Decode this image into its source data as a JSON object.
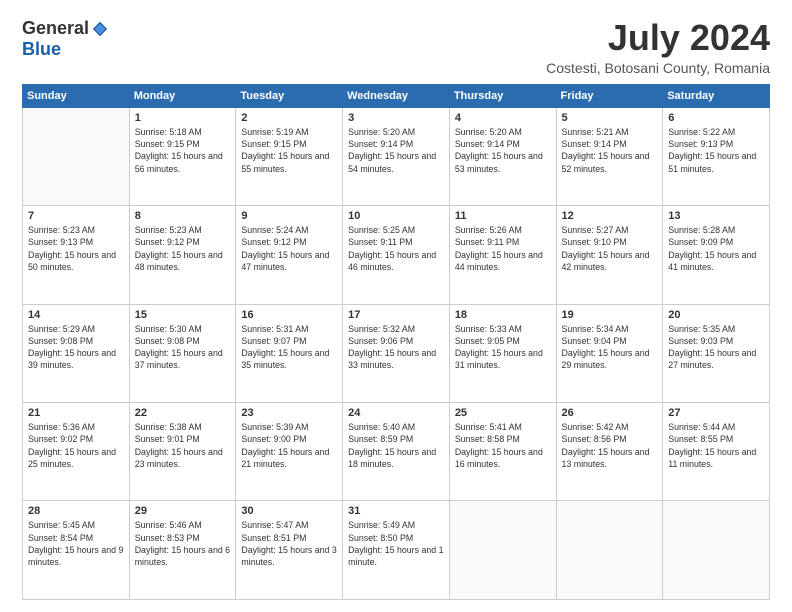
{
  "logo": {
    "general": "General",
    "blue": "Blue"
  },
  "title": {
    "month_year": "July 2024",
    "location": "Costesti, Botosani County, Romania"
  },
  "headers": [
    "Sunday",
    "Monday",
    "Tuesday",
    "Wednesday",
    "Thursday",
    "Friday",
    "Saturday"
  ],
  "weeks": [
    [
      {
        "day": "",
        "sunrise": "",
        "sunset": "",
        "daylight": ""
      },
      {
        "day": "1",
        "sunrise": "Sunrise: 5:18 AM",
        "sunset": "Sunset: 9:15 PM",
        "daylight": "Daylight: 15 hours and 56 minutes."
      },
      {
        "day": "2",
        "sunrise": "Sunrise: 5:19 AM",
        "sunset": "Sunset: 9:15 PM",
        "daylight": "Daylight: 15 hours and 55 minutes."
      },
      {
        "day": "3",
        "sunrise": "Sunrise: 5:20 AM",
        "sunset": "Sunset: 9:14 PM",
        "daylight": "Daylight: 15 hours and 54 minutes."
      },
      {
        "day": "4",
        "sunrise": "Sunrise: 5:20 AM",
        "sunset": "Sunset: 9:14 PM",
        "daylight": "Daylight: 15 hours and 53 minutes."
      },
      {
        "day": "5",
        "sunrise": "Sunrise: 5:21 AM",
        "sunset": "Sunset: 9:14 PM",
        "daylight": "Daylight: 15 hours and 52 minutes."
      },
      {
        "day": "6",
        "sunrise": "Sunrise: 5:22 AM",
        "sunset": "Sunset: 9:13 PM",
        "daylight": "Daylight: 15 hours and 51 minutes."
      }
    ],
    [
      {
        "day": "7",
        "sunrise": "Sunrise: 5:23 AM",
        "sunset": "Sunset: 9:13 PM",
        "daylight": "Daylight: 15 hours and 50 minutes."
      },
      {
        "day": "8",
        "sunrise": "Sunrise: 5:23 AM",
        "sunset": "Sunset: 9:12 PM",
        "daylight": "Daylight: 15 hours and 48 minutes."
      },
      {
        "day": "9",
        "sunrise": "Sunrise: 5:24 AM",
        "sunset": "Sunset: 9:12 PM",
        "daylight": "Daylight: 15 hours and 47 minutes."
      },
      {
        "day": "10",
        "sunrise": "Sunrise: 5:25 AM",
        "sunset": "Sunset: 9:11 PM",
        "daylight": "Daylight: 15 hours and 46 minutes."
      },
      {
        "day": "11",
        "sunrise": "Sunrise: 5:26 AM",
        "sunset": "Sunset: 9:11 PM",
        "daylight": "Daylight: 15 hours and 44 minutes."
      },
      {
        "day": "12",
        "sunrise": "Sunrise: 5:27 AM",
        "sunset": "Sunset: 9:10 PM",
        "daylight": "Daylight: 15 hours and 42 minutes."
      },
      {
        "day": "13",
        "sunrise": "Sunrise: 5:28 AM",
        "sunset": "Sunset: 9:09 PM",
        "daylight": "Daylight: 15 hours and 41 minutes."
      }
    ],
    [
      {
        "day": "14",
        "sunrise": "Sunrise: 5:29 AM",
        "sunset": "Sunset: 9:08 PM",
        "daylight": "Daylight: 15 hours and 39 minutes."
      },
      {
        "day": "15",
        "sunrise": "Sunrise: 5:30 AM",
        "sunset": "Sunset: 9:08 PM",
        "daylight": "Daylight: 15 hours and 37 minutes."
      },
      {
        "day": "16",
        "sunrise": "Sunrise: 5:31 AM",
        "sunset": "Sunset: 9:07 PM",
        "daylight": "Daylight: 15 hours and 35 minutes."
      },
      {
        "day": "17",
        "sunrise": "Sunrise: 5:32 AM",
        "sunset": "Sunset: 9:06 PM",
        "daylight": "Daylight: 15 hours and 33 minutes."
      },
      {
        "day": "18",
        "sunrise": "Sunrise: 5:33 AM",
        "sunset": "Sunset: 9:05 PM",
        "daylight": "Daylight: 15 hours and 31 minutes."
      },
      {
        "day": "19",
        "sunrise": "Sunrise: 5:34 AM",
        "sunset": "Sunset: 9:04 PM",
        "daylight": "Daylight: 15 hours and 29 minutes."
      },
      {
        "day": "20",
        "sunrise": "Sunrise: 5:35 AM",
        "sunset": "Sunset: 9:03 PM",
        "daylight": "Daylight: 15 hours and 27 minutes."
      }
    ],
    [
      {
        "day": "21",
        "sunrise": "Sunrise: 5:36 AM",
        "sunset": "Sunset: 9:02 PM",
        "daylight": "Daylight: 15 hours and 25 minutes."
      },
      {
        "day": "22",
        "sunrise": "Sunrise: 5:38 AM",
        "sunset": "Sunset: 9:01 PM",
        "daylight": "Daylight: 15 hours and 23 minutes."
      },
      {
        "day": "23",
        "sunrise": "Sunrise: 5:39 AM",
        "sunset": "Sunset: 9:00 PM",
        "daylight": "Daylight: 15 hours and 21 minutes."
      },
      {
        "day": "24",
        "sunrise": "Sunrise: 5:40 AM",
        "sunset": "Sunset: 8:59 PM",
        "daylight": "Daylight: 15 hours and 18 minutes."
      },
      {
        "day": "25",
        "sunrise": "Sunrise: 5:41 AM",
        "sunset": "Sunset: 8:58 PM",
        "daylight": "Daylight: 15 hours and 16 minutes."
      },
      {
        "day": "26",
        "sunrise": "Sunrise: 5:42 AM",
        "sunset": "Sunset: 8:56 PM",
        "daylight": "Daylight: 15 hours and 13 minutes."
      },
      {
        "day": "27",
        "sunrise": "Sunrise: 5:44 AM",
        "sunset": "Sunset: 8:55 PM",
        "daylight": "Daylight: 15 hours and 11 minutes."
      }
    ],
    [
      {
        "day": "28",
        "sunrise": "Sunrise: 5:45 AM",
        "sunset": "Sunset: 8:54 PM",
        "daylight": "Daylight: 15 hours and 9 minutes."
      },
      {
        "day": "29",
        "sunrise": "Sunrise: 5:46 AM",
        "sunset": "Sunset: 8:53 PM",
        "daylight": "Daylight: 15 hours and 6 minutes."
      },
      {
        "day": "30",
        "sunrise": "Sunrise: 5:47 AM",
        "sunset": "Sunset: 8:51 PM",
        "daylight": "Daylight: 15 hours and 3 minutes."
      },
      {
        "day": "31",
        "sunrise": "Sunrise: 5:49 AM",
        "sunset": "Sunset: 8:50 PM",
        "daylight": "Daylight: 15 hours and 1 minute."
      },
      {
        "day": "",
        "sunrise": "",
        "sunset": "",
        "daylight": ""
      },
      {
        "day": "",
        "sunrise": "",
        "sunset": "",
        "daylight": ""
      },
      {
        "day": "",
        "sunrise": "",
        "sunset": "",
        "daylight": ""
      }
    ]
  ]
}
